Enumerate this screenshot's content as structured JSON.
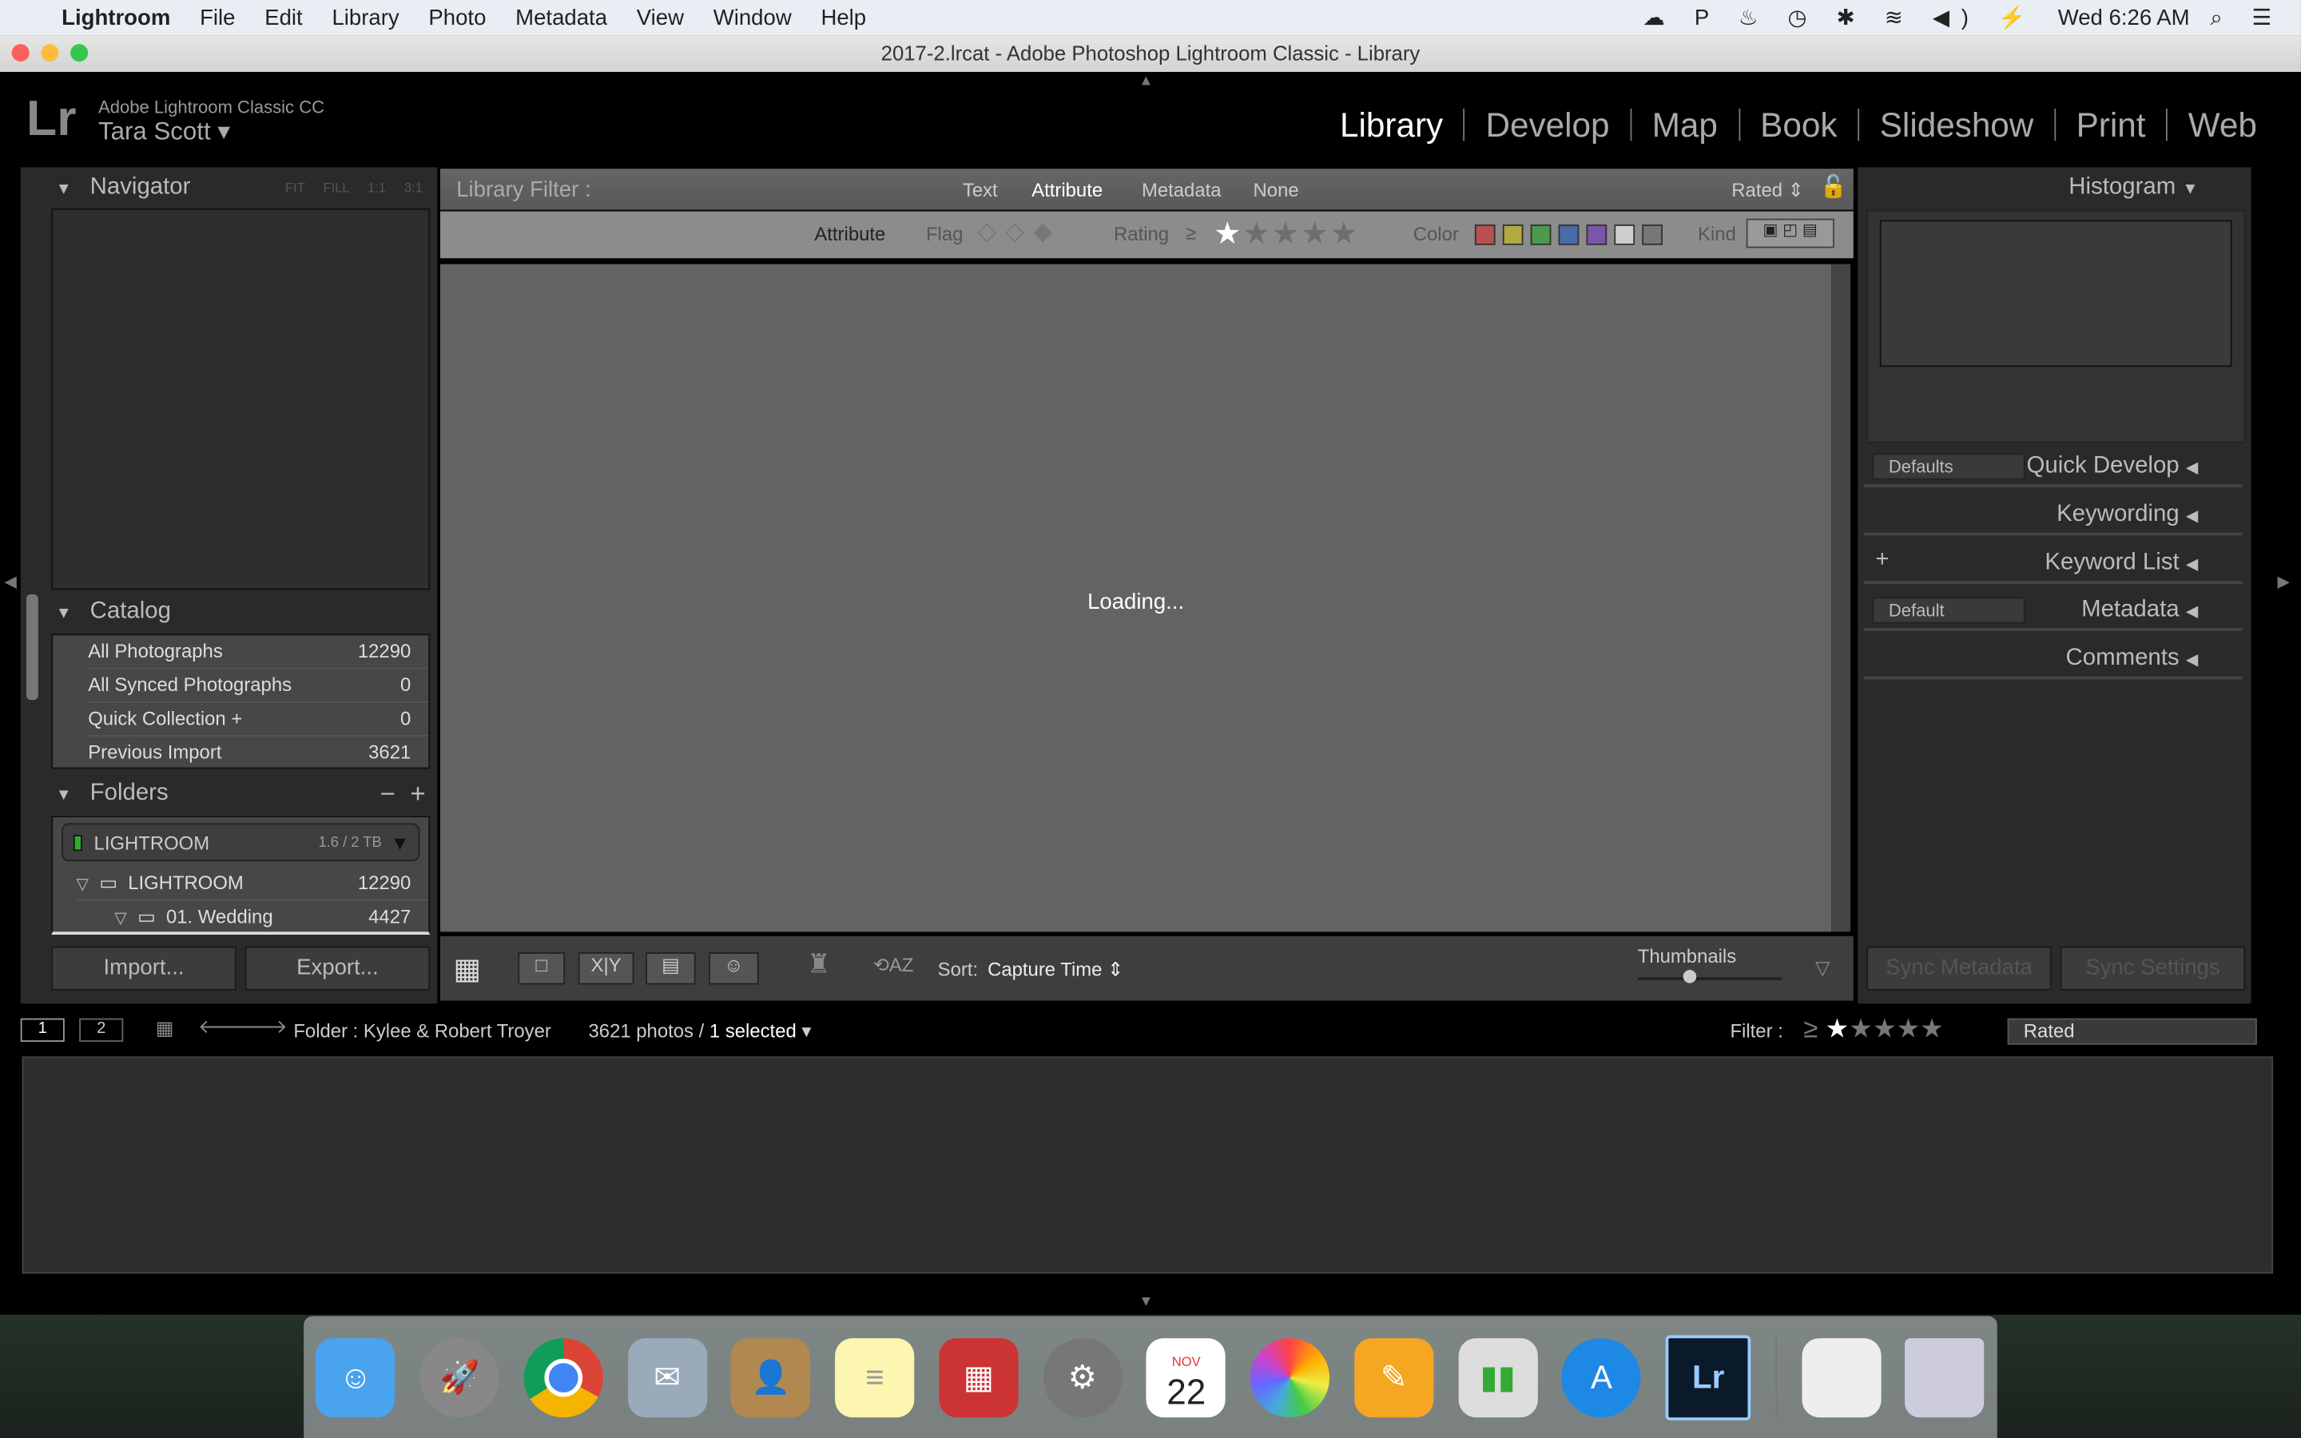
{
  "menubar": {
    "app": "Lightroom",
    "items": [
      "File",
      "Edit",
      "Library",
      "Photo",
      "Metadata",
      "View",
      "Window",
      "Help"
    ],
    "clock": "Wed 6:26 AM"
  },
  "window": {
    "title": "2017-2.lrcat - Adobe Photoshop Lightroom Classic - Library"
  },
  "identity": {
    "product": "Adobe Lightroom Classic CC",
    "user": "Tara Scott"
  },
  "modules": [
    "Library",
    "Develop",
    "Map",
    "Book",
    "Slideshow",
    "Print",
    "Web"
  ],
  "navigator": {
    "title": "Navigator",
    "zoom": [
      "FIT",
      "FILL",
      "1:1",
      "3:1"
    ]
  },
  "catalog": {
    "title": "Catalog",
    "items": [
      {
        "label": "All Photographs",
        "count": "12290"
      },
      {
        "label": "All Synced Photographs",
        "count": "0"
      },
      {
        "label": "Quick Collection  +",
        "count": "0"
      },
      {
        "label": "Previous Import",
        "count": "3621"
      }
    ]
  },
  "folders": {
    "title": "Folders",
    "volume": {
      "name": "LIGHTROOM",
      "space": "1.6 / 2 TB"
    },
    "items": [
      {
        "label": "LIGHTROOM",
        "count": "12290"
      },
      {
        "label": "01. Wedding",
        "count": "4427"
      }
    ]
  },
  "buttons": {
    "import": "Import...",
    "export": "Export...",
    "sync_metadata": "Sync Metadata",
    "sync_settings": "Sync Settings"
  },
  "filter": {
    "label": "Library Filter :",
    "tabs": [
      "Text",
      "Attribute",
      "Metadata",
      "None"
    ],
    "active": "Attribute",
    "preset": "Rated",
    "attr_label": "Attribute",
    "flag": "Flag",
    "rating": "Rating",
    "gte": "≥",
    "color": "Color",
    "kind": "Kind",
    "colors": [
      "#b85050",
      "#b0aa40",
      "#4c9a4c",
      "#4a6aaa",
      "#7a55aa",
      "#cfcfcf",
      "#777777"
    ],
    "rating_value": 1
  },
  "main": {
    "status": "Loading..."
  },
  "toolbar": {
    "sort_label": "Sort:",
    "sort_value": "Capture Time",
    "thumbnails": "Thumbnails"
  },
  "right": {
    "histogram": "Histogram",
    "quick_develop": "Quick Develop",
    "qd_preset": "Defaults",
    "keywording": "Keywording",
    "keyword_list": "Keyword List",
    "metadata": "Metadata",
    "md_preset": "Default",
    "comments": "Comments"
  },
  "filmstrip": {
    "screen1": "1",
    "screen2": "2",
    "source": "Folder : Kylee & Robert Troyer",
    "count": "3621 photos /",
    "selected": "1 selected",
    "filter_label": "Filter :",
    "filter_value": "Rated",
    "rating_value": 1
  },
  "dock": {
    "calendar_month": "NOV",
    "calendar_day": "22"
  }
}
